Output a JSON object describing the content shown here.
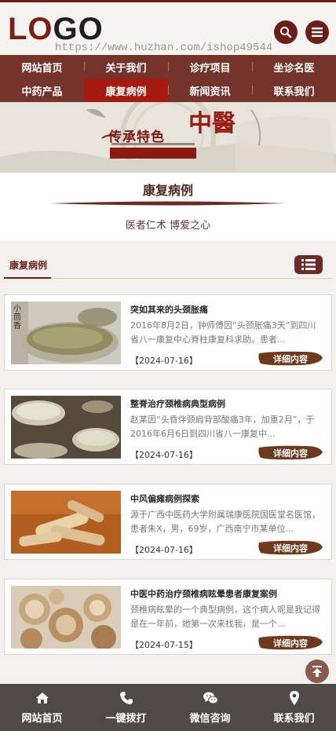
{
  "header": {
    "logo_prefix": "LO",
    "logo_suffix": "GO",
    "watermark": "https://www.huzhan.com/ishop49544"
  },
  "nav": {
    "items": [
      {
        "label": "网站首页"
      },
      {
        "label": "关于我们"
      },
      {
        "label": "诊疗项目"
      },
      {
        "label": "坐诊名医"
      },
      {
        "label": "中药产品"
      },
      {
        "label": "康复病例",
        "active": true
      },
      {
        "label": "新闻资讯"
      },
      {
        "label": "联系我们"
      }
    ]
  },
  "banner": {
    "text1": "传承特色",
    "text2": "中醫"
  },
  "section": {
    "title": "康复病例",
    "subtitle": "医者仁术 博爱之心"
  },
  "list": {
    "tab_label": "康复病例",
    "icon": "list-icon"
  },
  "articles": [
    {
      "title": "突如其来的头颈胀痛",
      "desc": "2016年8月2日，钟师傅因“头颈胀痛3天”到四川省八一康复中心脊柱康复科求助。患者...",
      "date": "【2024-07-16】",
      "more": "详细内容",
      "thumb_text": "小茴香"
    },
    {
      "title": "整脊治疗颈椎病典型病例",
      "desc": "赵某因“头昏伴颈肩背部酸痛3年，加重2月”，于2016年6月6日到四川省八一康复中...",
      "date": "【2024-07-16】",
      "more": "详细内容"
    },
    {
      "title": "中风偏瘫病例探索",
      "desc": "源于广西中医药大学附属瑞康医院国医堂名医馆，患者朱X，男，69岁，广西南宁市某单位...",
      "date": "【2024-07-16】",
      "more": "详细内容"
    },
    {
      "title": "中医中药治疗颈椎病眩晕患者康复案例",
      "desc": "颈椎病眩晕的一个典型病例，这个病人呢是我记得是在一年前，她第一次来找我，是一个...",
      "date": "【2024-07-15】",
      "more": "详细内容"
    }
  ],
  "footer": {
    "items": [
      {
        "label": "网站首页",
        "icon": "home-icon"
      },
      {
        "label": "一键拨打",
        "icon": "phone-icon"
      },
      {
        "label": "微信咨询",
        "icon": "wechat-icon"
      },
      {
        "label": "联系我们",
        "icon": "location-icon"
      }
    ]
  },
  "colors": {
    "brand": "#6b1f16",
    "nav_bg": "#74332b",
    "nav_active": "#a71a10",
    "footer_bg": "#4f4a49"
  }
}
